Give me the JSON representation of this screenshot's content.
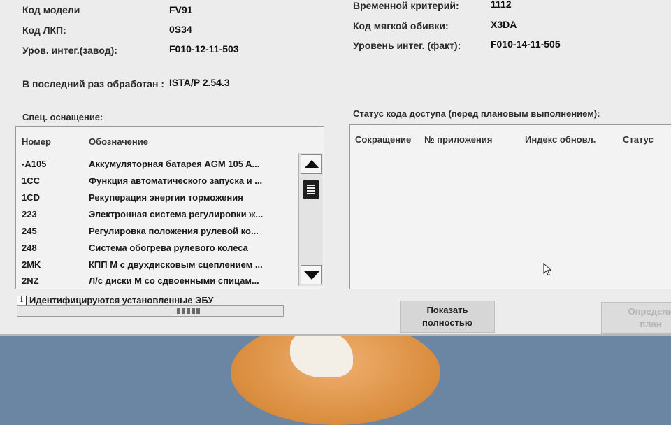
{
  "header": {
    "model_code_label": "Код модели",
    "model_code_value": "FV91",
    "paint_code_label": "Код ЛКП:",
    "paint_code_value": "0S34",
    "integ_level_factory_label": "Уров. интег.(завод):",
    "integ_level_factory_value": "F010-12-11-503",
    "time_criterion_label": "Временной критерий:",
    "time_criterion_value": "1112",
    "upholstery_code_label": "Код мягкой обивки:",
    "upholstery_code_value": "X3DA",
    "integ_level_actual_label": "Уровень интег. (факт):",
    "integ_level_actual_value": "F010-14-11-505",
    "last_processed_label": "В последний раз обработан :",
    "last_processed_value": "ISTA/P 2.54.3"
  },
  "equipment": {
    "title": "Спец. оснащение:",
    "columns": [
      "Номер",
      "Обозначение"
    ],
    "rows": [
      {
        "code": "-A105",
        "name": "Аккумуляторная батарея AGM 105 A..."
      },
      {
        "code": "1CC",
        "name": "Функция автоматического запуска и ..."
      },
      {
        "code": "1CD",
        "name": "Рекуперация энергии торможения"
      },
      {
        "code": "223",
        "name": "Электронная система регулировки ж..."
      },
      {
        "code": "245",
        "name": "Регулировка положения рулевой ко..."
      },
      {
        "code": "248",
        "name": "Система обогрева рулевого колеса"
      },
      {
        "code": "2MK",
        "name": "КПП М с двухдисковым сцеплением ..."
      },
      {
        "code": "2NZ",
        "name": "Л/с диски М со сдвоенными спицам..."
      }
    ]
  },
  "access_status": {
    "title": "Статус кода доступа (перед плановым выполнением):",
    "columns": [
      "Сокращение",
      "№ приложения",
      "Индекс обновл.",
      "Статус"
    ]
  },
  "status_bar": {
    "message": "Идентифицируются установленные ЭБУ",
    "info_icon": "i"
  },
  "buttons": {
    "show_full_line1": "Показать",
    "show_full_line2": "полностью",
    "determine_plan_line1": "Определи",
    "determine_plan_line2": "план"
  },
  "colors": {
    "window_bg": "#ececec",
    "disabled_text": "#b5b5b5"
  }
}
